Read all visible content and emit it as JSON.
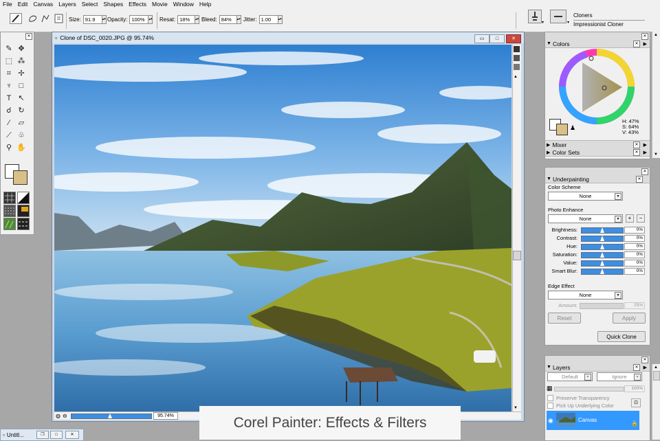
{
  "menu": [
    "File",
    "Edit",
    "Canvas",
    "Layers",
    "Select",
    "Shapes",
    "Effects",
    "Movie",
    "Window",
    "Help"
  ],
  "property_bar": {
    "size_label": "Size:",
    "size": "91.9",
    "opacity_label": "Opacity:",
    "opacity": "100%",
    "resat_label": "Resat:",
    "resat": "18%",
    "bleed_label": "Bleed:",
    "bleed": "84%",
    "jitter_label": "Jitter:",
    "jitter": "1.00",
    "brush_category": "Cloners",
    "brush_variant": "Impressionist Cloner"
  },
  "document": {
    "title": "Clone of DSC_0020.JPG @ 95.74%",
    "zoom": "95.74%",
    "zoom_level": 0.9574
  },
  "colors_panel": {
    "title": "Colors",
    "h": "H: 47%",
    "s": "S: 64%",
    "v": "V: 43%",
    "mixer": "Mixer",
    "color_sets": "Color Sets"
  },
  "underpainting": {
    "title": "Underpainting",
    "color_scheme_label": "Color Scheme",
    "color_scheme": "None",
    "photo_enhance_label": "Photo Enhance",
    "photo_enhance": "None",
    "sliders": [
      {
        "label": "Brightness:",
        "value": "0%"
      },
      {
        "label": "Contrast:",
        "value": "0%"
      },
      {
        "label": "Hue:",
        "value": "0%"
      },
      {
        "label": "Saturation:",
        "value": "0%"
      },
      {
        "label": "Value:",
        "value": "0%"
      },
      {
        "label": "Smart Blur:",
        "value": "0%"
      }
    ],
    "edge_effect_label": "Edge Effect",
    "edge_effect": "None",
    "amount_label": "Amount:",
    "amount": "25%",
    "reset": "Reset",
    "apply": "Apply",
    "quick_clone": "Quick Clone"
  },
  "layers_panel": {
    "title": "Layers",
    "composite_method": "Default",
    "composite_depth": "Ignore",
    "opacity": "100%",
    "preserve_transparency": "Preserve Transparency",
    "pick_up_underlying": "Pick Up Underlying Color",
    "layer_name": "Canvas"
  },
  "taskbar": {
    "doc_label": "Untitl..."
  },
  "caption": "Corel Painter: Effects & Filters",
  "colors": {
    "selection_blue": "#3399ff",
    "chrome": "#f0f0f0",
    "doc_border": "#6f86a0"
  }
}
